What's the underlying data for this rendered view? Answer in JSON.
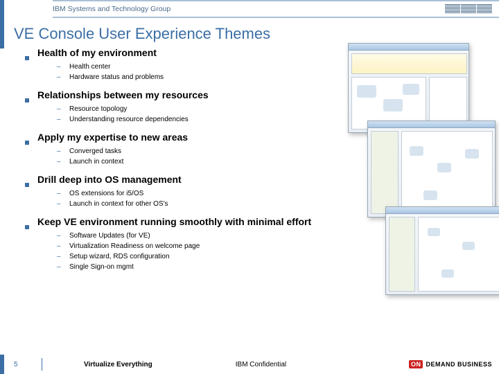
{
  "header": {
    "group": "IBM Systems and Technology Group"
  },
  "title": "VE Console User Experience Themes",
  "themes": [
    {
      "head": "Health of my environment",
      "subs": [
        "Health center",
        "Hardware status and problems"
      ]
    },
    {
      "head": "Relationships between my resources",
      "subs": [
        "Resource topology",
        "Understanding resource dependencies"
      ]
    },
    {
      "head": "Apply my expertise to new areas",
      "subs": [
        "Converged tasks",
        "Launch in context"
      ]
    },
    {
      "head": "Drill deep into OS management",
      "subs": [
        "OS extensions for i5/OS",
        "Launch in context for other OS's"
      ]
    },
    {
      "head": "Keep VE environment running smoothly with minimal effort",
      "subs": [
        "Software Updates (for VE)",
        "Virtualization Readiness on welcome page",
        "Setup wizard, RDS configuration",
        "Single Sign-on mgmt"
      ]
    }
  ],
  "footer": {
    "page": "5",
    "tagline": "Virtualize Everything",
    "confidential": "IBM Confidential",
    "brand_on": "ON",
    "brand_rest": "DEMAND BUSINESS"
  }
}
